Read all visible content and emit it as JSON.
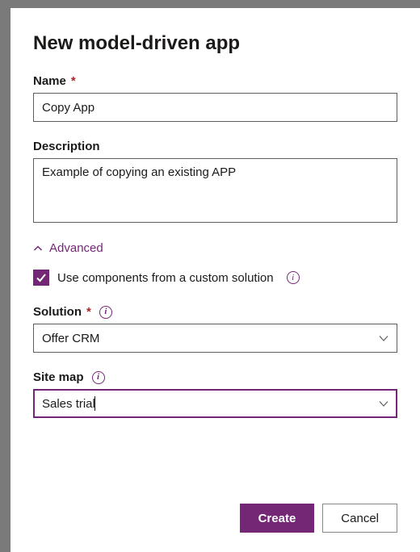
{
  "colors": {
    "accent": "#742774",
    "border": "#605e5c",
    "text": "#1b1a19",
    "required": "#a4262c"
  },
  "title": "New model-driven app",
  "fields": {
    "name": {
      "label": "Name",
      "required": true,
      "value": "Copy App"
    },
    "description": {
      "label": "Description",
      "required": false,
      "value": "Example of copying an existing APP"
    },
    "advanced_label": "Advanced",
    "use_custom": {
      "label": "Use components from a custom solution",
      "checked": true
    },
    "solution": {
      "label": "Solution",
      "required": true,
      "value": "Offer CRM"
    },
    "sitemap": {
      "label": "Site map",
      "required": false,
      "value": "Sales trial"
    }
  },
  "buttons": {
    "create": "Create",
    "cancel": "Cancel"
  }
}
